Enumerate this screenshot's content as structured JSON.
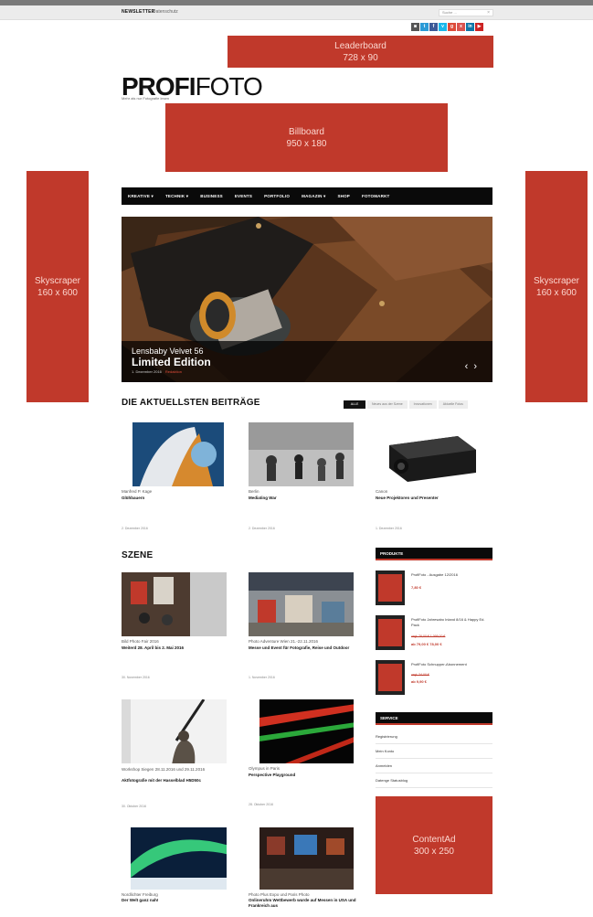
{
  "topbar": {
    "newsletter": "NEWSLETTER",
    "datenschutz": "Datenschutz",
    "search_placeholder": "Suche ...",
    "search_close": "×"
  },
  "social": [
    {
      "icon": "instagram-icon",
      "glyph": "◙",
      "color": "#555555"
    },
    {
      "icon": "twitter-icon",
      "glyph": "t",
      "color": "#2a9ad6"
    },
    {
      "icon": "facebook-icon",
      "glyph": "f",
      "color": "#3b5998"
    },
    {
      "icon": "vimeo-icon",
      "glyph": "v",
      "color": "#1ab7ea"
    },
    {
      "icon": "googleplus-icon",
      "glyph": "g",
      "color": "#dd4b39"
    },
    {
      "icon": "xing-icon",
      "glyph": "x",
      "color": "#d9534f"
    },
    {
      "icon": "linkedin-icon",
      "glyph": "in",
      "color": "#0e76a8"
    },
    {
      "icon": "youtube-icon",
      "glyph": "▶",
      "color": "#cc2222"
    }
  ],
  "ads": {
    "leaderboard": {
      "name": "Leaderboard",
      "size": "728 x 90"
    },
    "billboard": {
      "name": "Billboard",
      "size": "950 x 180"
    },
    "skyscraper_left": {
      "name": "Skyscraper",
      "size": "160 x 600"
    },
    "skyscraper_right": {
      "name": "Skyscraper",
      "size": "160 x 600"
    },
    "contentad": {
      "name": "ContentAd",
      "size": "300 x 250"
    }
  },
  "logo": {
    "bold": "PROFI",
    "light": "FOTO",
    "tagline": "Mehr als nur Fotografie lesen"
  },
  "nav": [
    "KREATIVE ▾",
    "TECHNIK ▾",
    "BUSINESS",
    "EVENTS",
    "PORTFOLIO",
    "MAGAZIN ▾",
    "SHOP",
    "FOTOMARKT"
  ],
  "hero": {
    "subtitle": "Lensbaby Velvet 56",
    "title": "Limited Edition",
    "date": "1. Dezember 2016",
    "author": "Redaktion"
  },
  "latest": {
    "heading": "DIE AKTUELLSTEN BEITRÄGE",
    "tabs": [
      "ALLE",
      "Neues aus der Szene",
      "Innovationen",
      "Aktuelle Fotos"
    ],
    "cards": [
      {
        "cat": "Manfred P. Kage",
        "title": "Glühbauern",
        "date": "2. Dezember 2016"
      },
      {
        "cat": "Berlin",
        "title": "Mediating War",
        "date": "2. Dezember 2016"
      },
      {
        "cat": "Canon",
        "title": "Neue Projektoren und Presenter",
        "date": "1. Dezember 2016"
      }
    ]
  },
  "szene": {
    "heading": "SZENE",
    "cards": [
      {
        "cat": "Bild Photo Fair 2016",
        "title": "Weiterd 28. April bis 2. Mai 2016",
        "date": "30. November 2016"
      },
      {
        "cat": "Photo Adventure Wien 21.-22.11.2016",
        "title": "Messe und Event für Fotografie, Reise und Outdoor",
        "date": "1. November 2016"
      },
      {
        "cat": "Workshop Siegen 28.11.2016 und 29.11.2016",
        "title": "Aktfotografie mit der Hasselblad H5D50c",
        "date": "30. Oktober 2016"
      },
      {
        "cat": "Olympus in Paris",
        "title": "Perspective Playground",
        "date": "28. Oktober 2016"
      },
      {
        "cat": "Nordlichter Freiburg",
        "title": "Der Welt ganz nah!",
        "date": ""
      },
      {
        "cat": "Photo Plus Expo und Paris Photo",
        "title": "Onlineruhm Wettbewerb wurde auf Messen in USA und Frankreich aus",
        "date": ""
      }
    ]
  },
  "sidebar": {
    "produkte_heading": "PRODUKTE",
    "products": [
      {
        "title": "ProfiFoto - Ausgabe 12/2016",
        "old": "",
        "price": "7,80 €"
      },
      {
        "title": "ProfiFoto Jahresabo Inland 8/16 & Happy Ed. Pack",
        "old": "zzgl. 76,00 € 1.095,00 €",
        "price": "ab 79,00 € 78,00 €"
      },
      {
        "title": "ProfiFoto Schnupper-Abonnement",
        "old": "zzgl. 24,00 €",
        "price": "ab 9,90 €"
      }
    ],
    "service_heading": "SERVICE",
    "service": [
      "Registrierung",
      "Mein Konto",
      "Anmelden",
      "Datenge Statusblog"
    ]
  }
}
